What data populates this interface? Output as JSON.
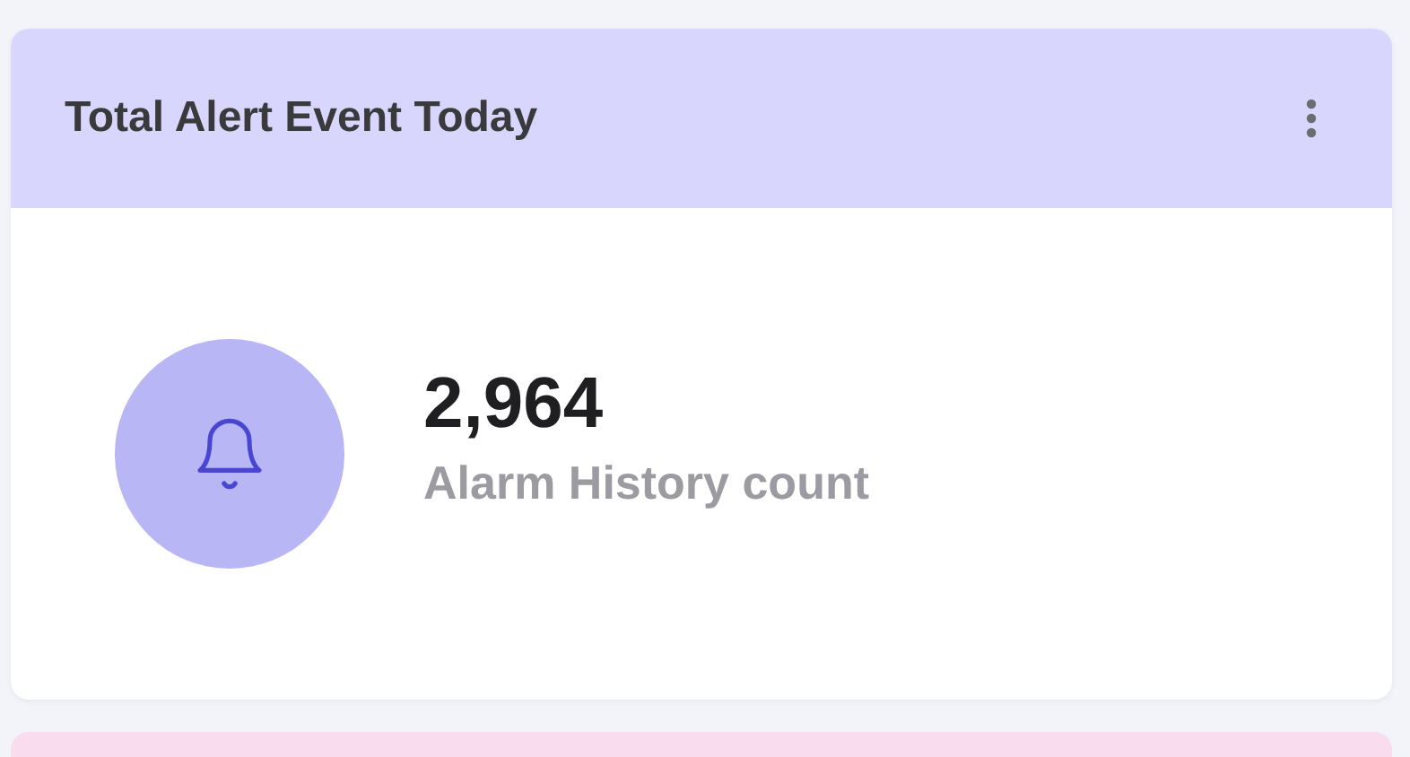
{
  "card": {
    "title": "Total Alert Event Today",
    "value": "2,964",
    "label": "Alarm History count"
  }
}
